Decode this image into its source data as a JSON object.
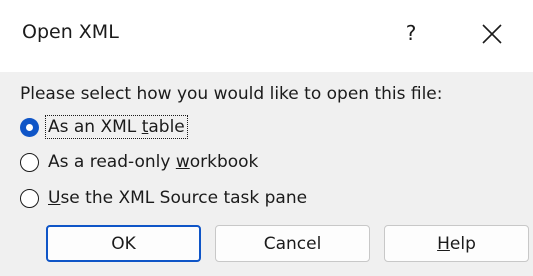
{
  "dialog": {
    "title": "Open XML",
    "help_label": "?",
    "prompt": "Please select how you would like to open this file:"
  },
  "options": [
    {
      "pre": "As an XML ",
      "accel": "t",
      "post": "able",
      "selected": true
    },
    {
      "pre": "As a read-only ",
      "accel": "w",
      "post": "orkbook",
      "selected": false
    },
    {
      "pre": "",
      "accel": "U",
      "post": "se the XML Source task pane",
      "selected": false
    }
  ],
  "buttons": {
    "ok": "OK",
    "cancel": "Cancel",
    "help_accel": "H",
    "help_rest": "elp"
  },
  "colors": {
    "accent": "#0f55c7",
    "titlebar": "#ffffff",
    "body": "#f0f0f0"
  }
}
